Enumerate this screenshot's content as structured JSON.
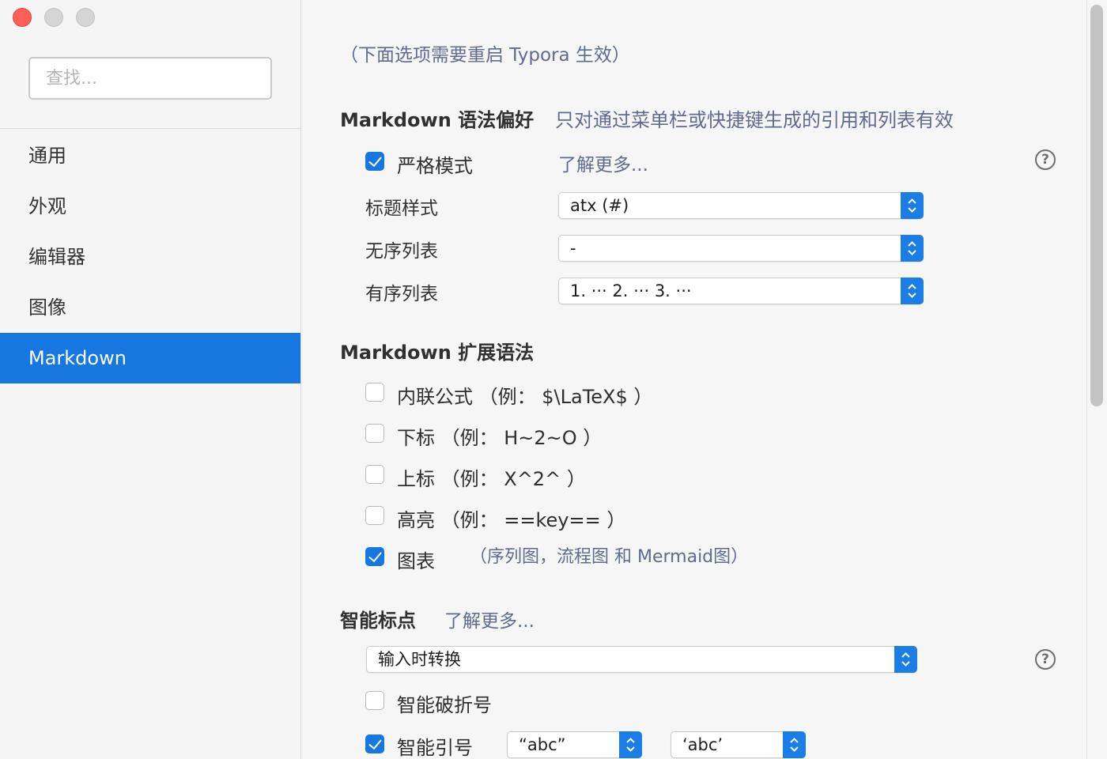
{
  "window": {
    "traffic_lights": {
      "close": "#fe5f57",
      "minimize": "#d5d5d5",
      "maximize": "#d5d5d5"
    }
  },
  "sidebar": {
    "search": {
      "placeholder": "查找...",
      "value": ""
    },
    "items": [
      {
        "label": "通用",
        "active": false
      },
      {
        "label": "外观",
        "active": false
      },
      {
        "label": "编辑器",
        "active": false
      },
      {
        "label": "图像",
        "active": false
      },
      {
        "label": "Markdown",
        "active": true
      }
    ],
    "accent": "#1677e0"
  },
  "main": {
    "restart_note": "（下面选项需要重启 Typora 生效）",
    "syntax_pref": {
      "title": "Markdown 语法偏好",
      "subtitle": "只对通过菜单栏或快捷键生成的引用和列表有效",
      "strict_mode": {
        "label": "严格模式",
        "checked": true
      },
      "learn_more": "了解更多...",
      "help_icon": "question-circle-icon",
      "heading_style": {
        "label": "标题样式",
        "value": "atx (#)"
      },
      "unordered_list": {
        "label": "无序列表",
        "value": "-"
      },
      "ordered_list": {
        "label": "有序列表",
        "value": "1. ··· 2. ··· 3. ···"
      }
    },
    "extended_syntax": {
      "title": "Markdown 扩展语法",
      "inline_math": {
        "label": "内联公式 （例： $\\LaTeX$ ）",
        "checked": false
      },
      "subscript": {
        "label": "下标 （例： H~2~O ）",
        "checked": false
      },
      "superscript": {
        "label": "上标 （例： X^2^ ）",
        "checked": false
      },
      "highlight": {
        "label": "高亮 （例： ==key== ）",
        "checked": false
      },
      "diagrams": {
        "label": "图表",
        "note": "（序列图，流程图 和 Mermaid图）",
        "checked": true
      }
    },
    "smart_punct": {
      "title": "智能标点",
      "learn_more": "了解更多...",
      "mode": {
        "value": "输入时转换"
      },
      "help_icon": "question-circle-icon",
      "smart_dash": {
        "label": "智能破折号",
        "checked": false
      },
      "smart_quotes": {
        "label": "智能引号",
        "checked": true,
        "double_value": "“abc”",
        "single_value": "‘abc’"
      }
    }
  }
}
